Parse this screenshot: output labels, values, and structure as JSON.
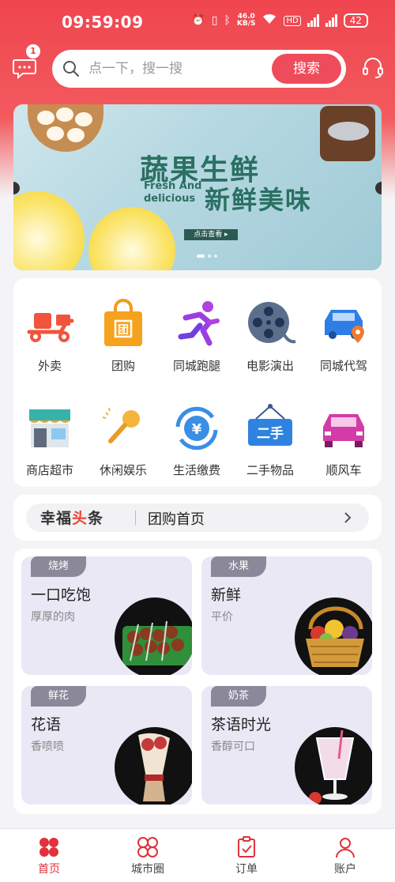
{
  "status_bar": {
    "time": "09:59:09",
    "net_speed_value": "46.0",
    "net_speed_unit": "KB/S",
    "battery": "42"
  },
  "header": {
    "message_badge": "1",
    "search_placeholder": "点一下，搜一搜",
    "search_button": "搜索"
  },
  "banner": {
    "title_cn_1": "蔬果生鲜",
    "title_en_1": "Fresh And",
    "title_en_2": "delicious",
    "title_cn_2": "新鲜美味",
    "cta": "点击查看 ▸"
  },
  "services": [
    {
      "label": "外卖",
      "icon": "scooter-icon"
    },
    {
      "label": "团购",
      "icon": "shopping-bag-icon"
    },
    {
      "label": "同城跑腿",
      "icon": "runner-icon"
    },
    {
      "label": "电影演出",
      "icon": "film-reel-icon"
    },
    {
      "label": "同城代驾",
      "icon": "car-location-icon"
    },
    {
      "label": "商店超市",
      "icon": "store-icon"
    },
    {
      "label": "休闲娱乐",
      "icon": "microphone-icon"
    },
    {
      "label": "生活缴费",
      "icon": "yuan-refresh-icon"
    },
    {
      "label": "二手物品",
      "icon": "secondhand-sign-icon"
    },
    {
      "label": "顺风车",
      "icon": "car-icon"
    }
  ],
  "headline": {
    "logo_a": "幸福",
    "logo_b": "头",
    "logo_c": "条",
    "text": "团购首页"
  },
  "products": [
    {
      "tag": "烧烤",
      "title": "一口吃饱",
      "subtitle": "厚厚的肉"
    },
    {
      "tag": "水果",
      "title": "新鲜",
      "subtitle": "平价"
    },
    {
      "tag": "鲜花",
      "title": "花语",
      "subtitle": "香喷喷"
    },
    {
      "tag": "奶茶",
      "title": "茶语时光",
      "subtitle": "香醇可口"
    }
  ],
  "tabbar": [
    {
      "label": "首页",
      "active": true
    },
    {
      "label": "城市圈",
      "active": false
    },
    {
      "label": "订单",
      "active": false
    },
    {
      "label": "账户",
      "active": false
    }
  ],
  "colors": {
    "brand_red": "#ef4c5b",
    "tag_gray": "#8b8899",
    "card_lavender": "#ebe8f6"
  }
}
